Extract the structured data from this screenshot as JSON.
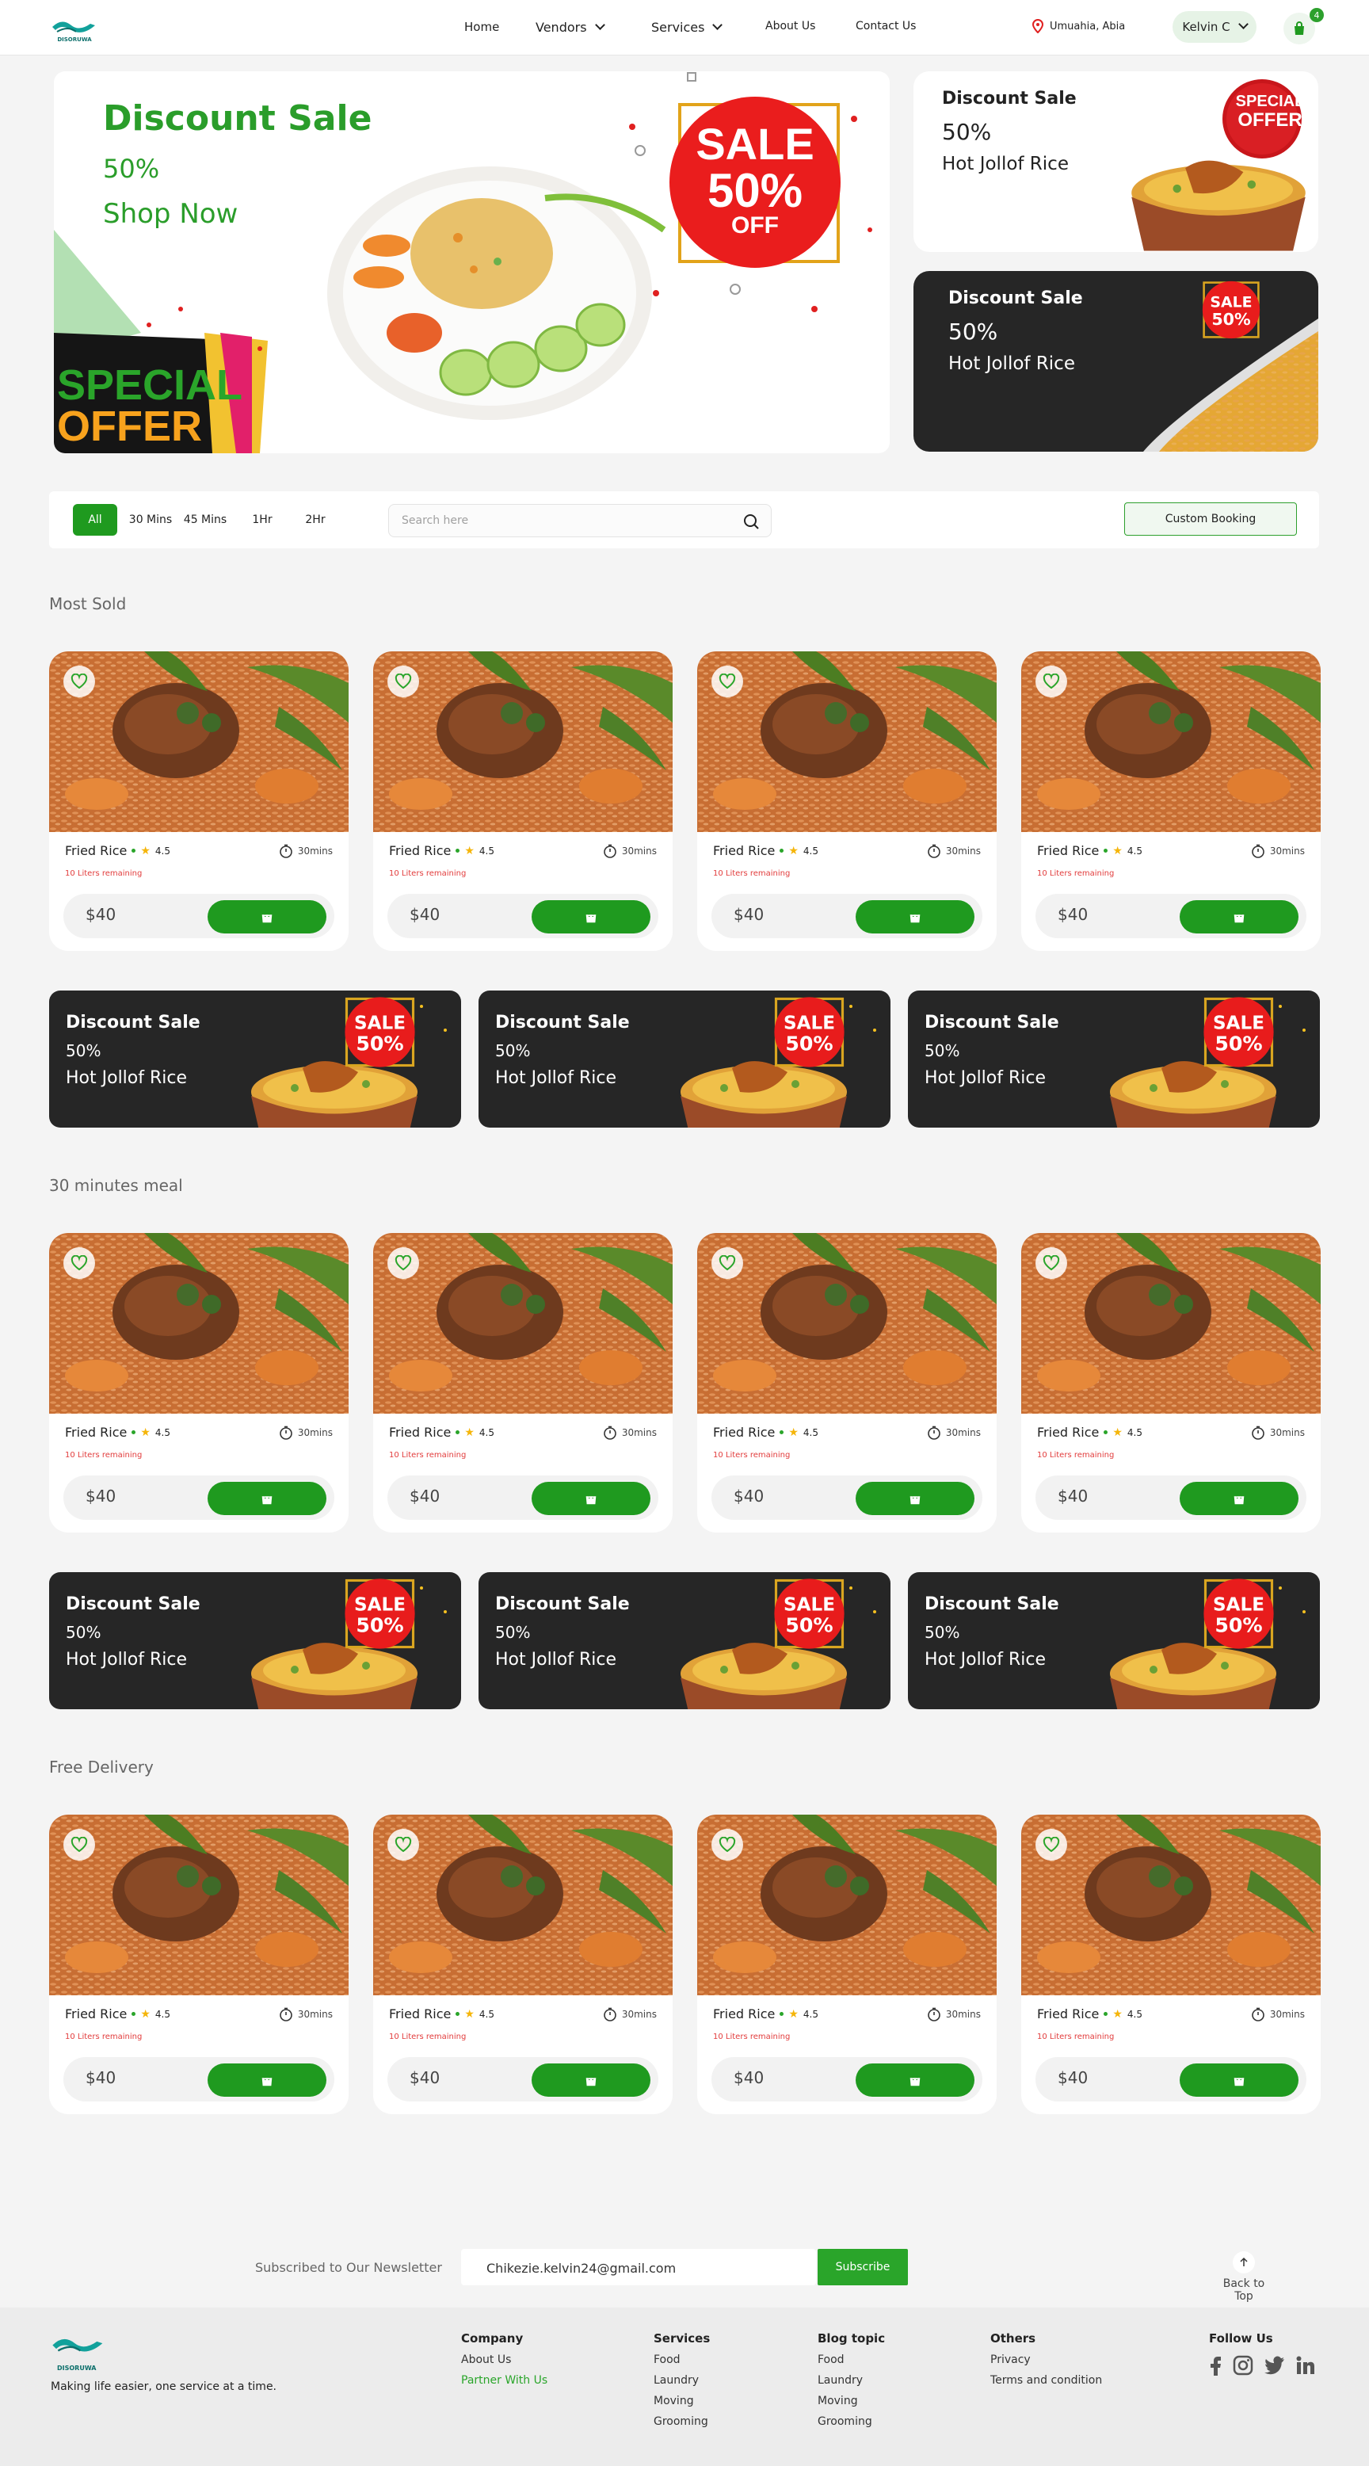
{
  "header": {
    "logo_text": "DISORUWA",
    "nav": [
      "Home",
      "Vendors",
      "Services",
      "About Us",
      "Contact Us"
    ],
    "location": "Umuahia, Abia",
    "user": "Kelvin C",
    "cart_count": "4"
  },
  "hero": {
    "title": "Discount Sale",
    "percent": "50%",
    "cta": "Shop Now",
    "badge_top": "SALE",
    "badge_mid": "50%",
    "badge_bot": "OFF",
    "special_1": "SPECIAL",
    "special_2": "OFFER"
  },
  "side_cards": [
    {
      "title": "Discount Sale",
      "percent": "50%",
      "text": "Hot Jollof Rice",
      "badge_1": "SPECIAL",
      "badge_2": "OFFER"
    },
    {
      "title": "Discount Sale",
      "percent": "50%",
      "text": "Hot Jollof Rice",
      "badge": "SALE 50%"
    }
  ],
  "filters": {
    "chips": [
      "All",
      "30 Mins",
      "45 Mins",
      "1Hr",
      "2Hr"
    ],
    "search_placeholder": "Search here",
    "custom_booking": "Custom Booking"
  },
  "sections": [
    {
      "title": "Most Sold"
    },
    {
      "title": "30 minutes meal"
    },
    {
      "title": "Free Delivery"
    }
  ],
  "product": {
    "name": "Fried Rice",
    "rating": "4.5",
    "time": "30mins",
    "remaining": "10 Liters remaining",
    "price": "$40"
  },
  "promo": {
    "title": "Discount Sale",
    "percent": "50%",
    "text": "Hot Jollof Rice",
    "badge": "SALE 50%"
  },
  "newsletter": {
    "label": "Subscribed to Our Newsletter",
    "email": "Chikezie.kelvin24@gmail.com",
    "button": "Subscribe",
    "back_to_top": "Back to Top"
  },
  "footer": {
    "tagline": "Making life easier, one service at a time.",
    "company": {
      "title": "Company",
      "links": [
        "About Us",
        "Partner With Us"
      ]
    },
    "services": {
      "title": "Services",
      "links": [
        "Food",
        "Laundry",
        "Moving",
        "Grooming"
      ]
    },
    "blog": {
      "title": "Blog topic",
      "links": [
        "Food",
        "Laundry",
        "Moving",
        "Grooming"
      ]
    },
    "others": {
      "title": "Others",
      "links": [
        "Privacy",
        "Terms and condition"
      ]
    },
    "follow": {
      "title": "Follow Us",
      "icons": [
        "facebook-icon",
        "instagram-icon",
        "twitter-icon",
        "linkedin-icon"
      ]
    }
  },
  "colors": {
    "brand_green": "#1f9a1f",
    "dark_card": "#262626",
    "sale_red": "#e81c1c"
  }
}
